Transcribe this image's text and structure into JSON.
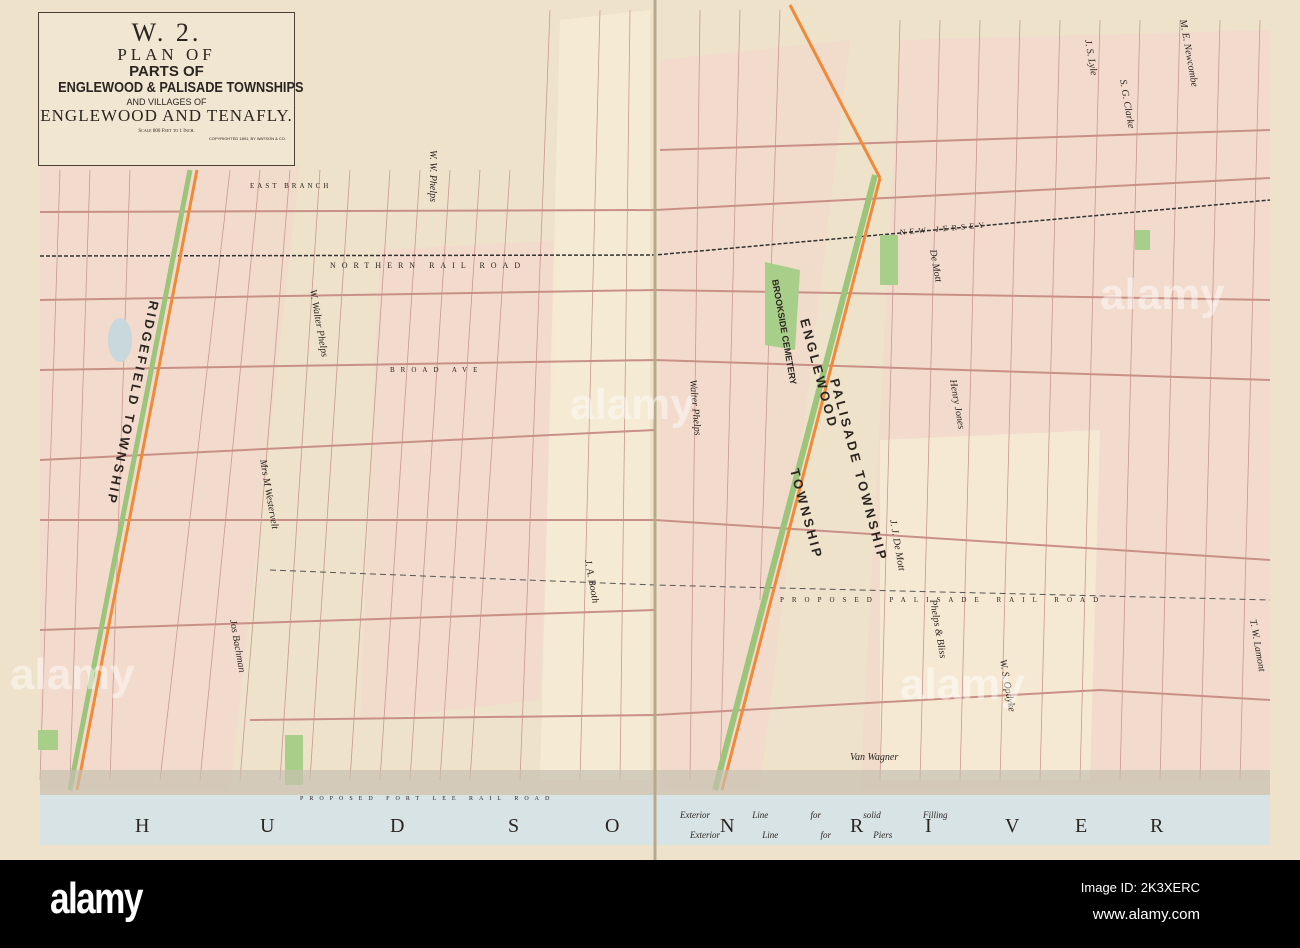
{
  "title_block": {
    "plate": "W. 2.",
    "line1": "PLAN OF",
    "line2": "PARTS OF",
    "line3": "ENGLEWOOD & PALISADE TOWNSHIPS",
    "line4": "AND VILLAGES OF",
    "line5": "ENGLEWOOD AND TENAFLY.",
    "scale": "Scale 800 Feet to 1 Inch.",
    "copyright": "COPYRIGHTED 1891, BY WATSON & CO."
  },
  "map_labels": {
    "river": [
      "H",
      "U",
      "D",
      "S",
      "O",
      "N",
      "R",
      "I",
      "V",
      "E",
      "R"
    ],
    "exterior_solid": "Exterior Line for solid Filling",
    "exterior_piers": "Exterior Line for Piers",
    "northern_rr": "NORTHERN RAIL ROAD",
    "new_jersey": "NEW JERSEY",
    "proposed_palisade": "PROPOSED PALISADE RAIL ROAD",
    "proposed_fort_lee": "PROPOSED FORT LEE RAIL ROAD",
    "englewood_twp": "ENGLEWOOD",
    "palisade_twp": "PALISADE TOWNSHIP",
    "township": "TOWNSHIP",
    "ridgefield_twp": "RIDGEFIELD TOWNSHIP",
    "brookside_cemetery": "BROOKSIDE CEMETERY",
    "east_branch": "EAST BRANCH",
    "broad_ave": "BROAD AVE",
    "owners": [
      "W. W. Phelps",
      "Walter Phelps",
      "J. S. Lyle",
      "M. E. Newcombe",
      "S. G. Clarke",
      "Van Wagner",
      "Jos Bachman",
      "Mrs M Westervelt",
      "W. Walter Phelps",
      "De Mott",
      "J. J. De Mott",
      "Phelps & Bliss",
      "W. S. Opdyke",
      "T. W. Lamont",
      "J. A. Booth",
      "Henry Jones"
    ]
  },
  "watermark": {
    "text": "alamy"
  },
  "footer": {
    "logo": "alamy",
    "image_id": "Image ID: 2K3XERC",
    "site": "www.alamy.com"
  },
  "colors": {
    "paper": "#eee2cb",
    "pink_roads": "#d9a9a0",
    "green": "#9cc47a",
    "orange": "#f08a3a",
    "river": "#d8e3e6"
  }
}
